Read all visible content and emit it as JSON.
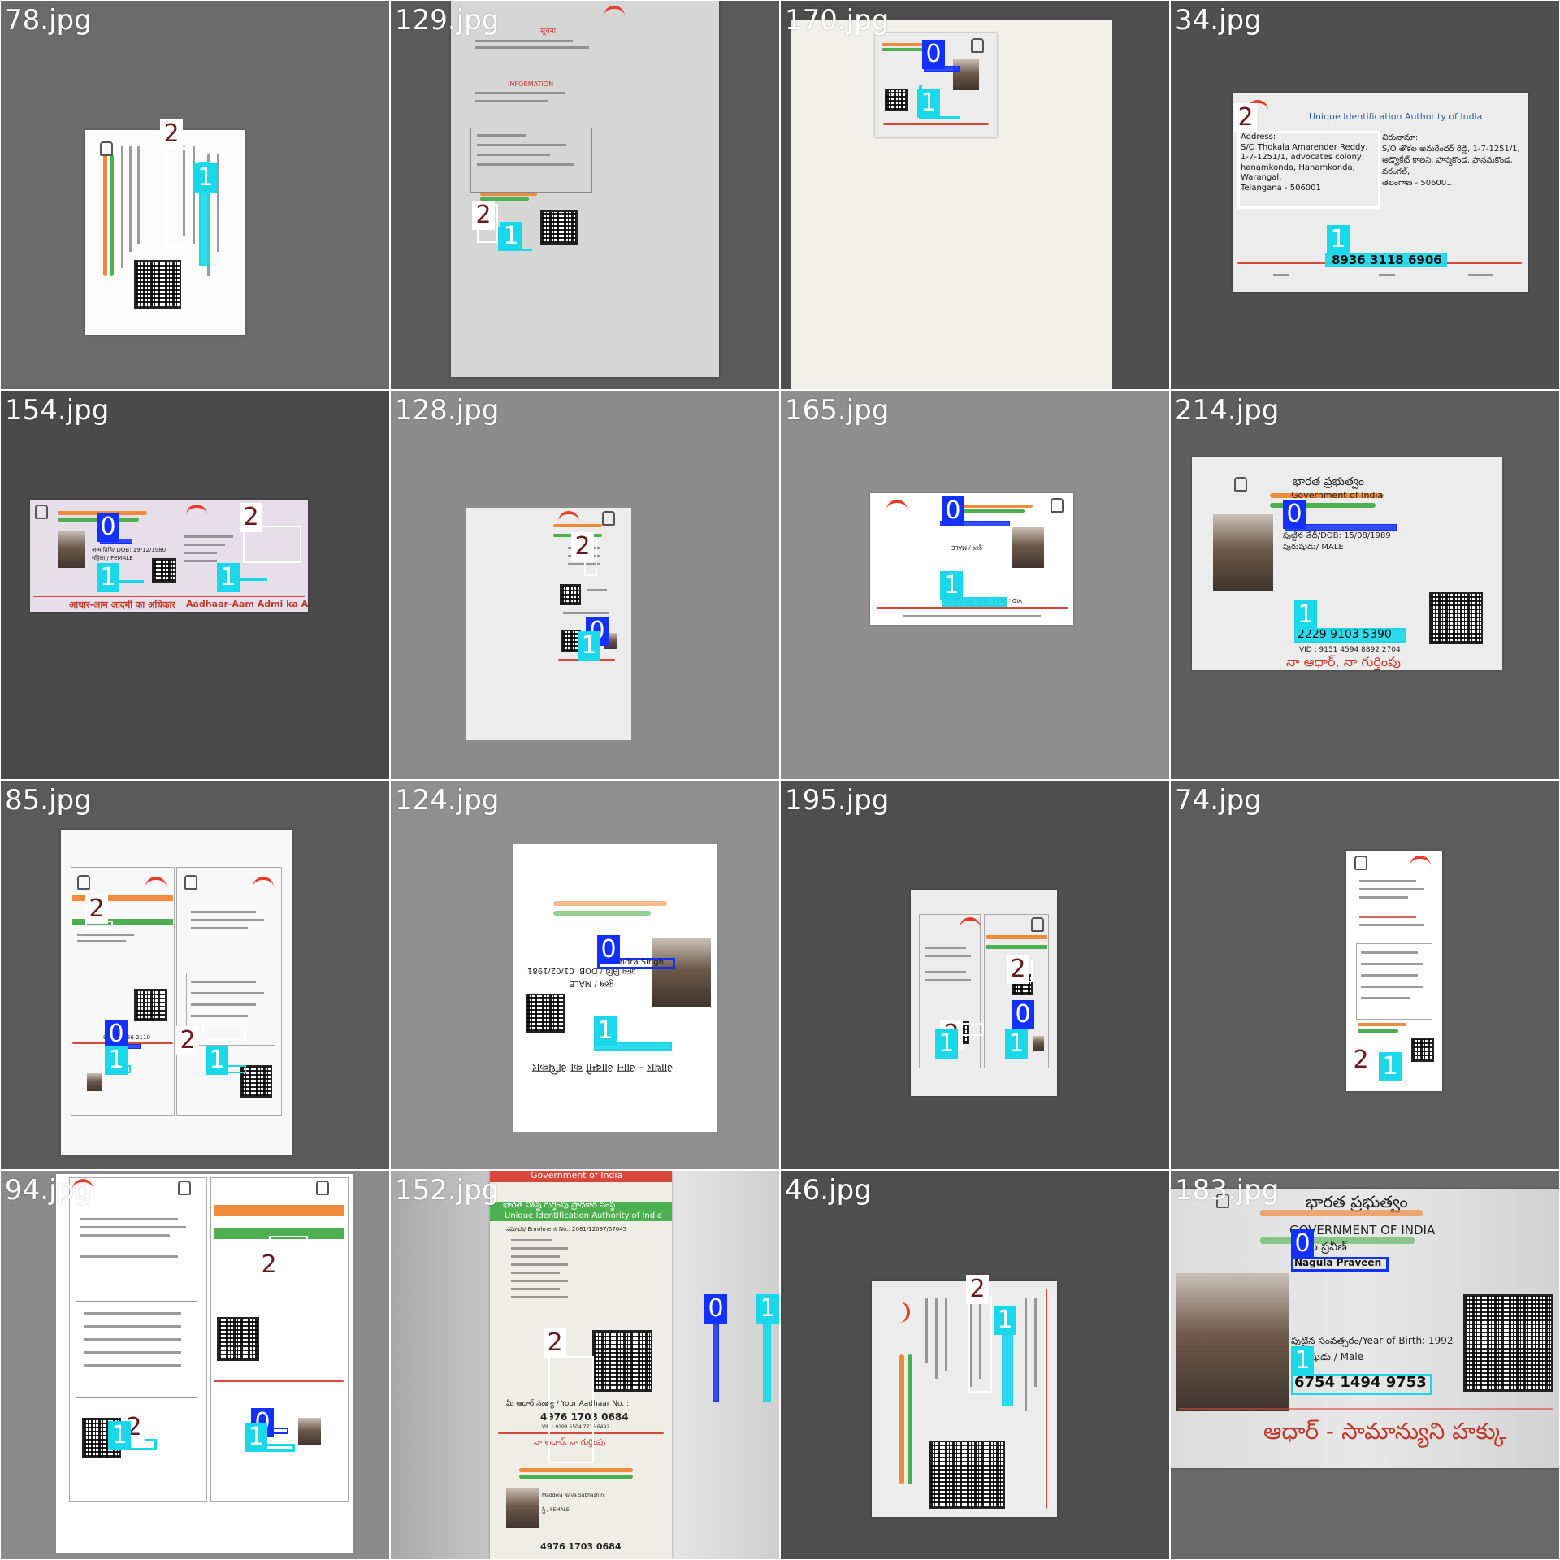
{
  "tiles": [
    {
      "file": "78.jpg",
      "bg": "#6b6b6b"
    },
    {
      "file": "129.jpg",
      "bg": "#5a5a5a"
    },
    {
      "file": "170.jpg",
      "bg": "#4d4d4d"
    },
    {
      "file": "34.jpg",
      "bg": "#4f4f4f"
    },
    {
      "file": "154.jpg",
      "bg": "#4a4a4a"
    },
    {
      "file": "128.jpg",
      "bg": "#8c8c8c"
    },
    {
      "file": "165.jpg",
      "bg": "#8e8e8e"
    },
    {
      "file": "214.jpg",
      "bg": "#5e5e5e"
    },
    {
      "file": "85.jpg",
      "bg": "#5a5a5a"
    },
    {
      "file": "124.jpg",
      "bg": "#8f8f8f"
    },
    {
      "file": "195.jpg",
      "bg": "#4f4f4f"
    },
    {
      "file": "74.jpg",
      "bg": "#5d5d5d"
    },
    {
      "file": "94.jpg",
      "bg": "#8a8a8a"
    },
    {
      "file": "152.jpg",
      "bg": "#bdbdbd"
    },
    {
      "file": "46.jpg",
      "bg": "#4e4e4e"
    },
    {
      "file": "183.jpg",
      "bg": "#6a6a6a"
    }
  ],
  "labels": {
    "l0": "0",
    "l1": "1",
    "l2": "2"
  },
  "colors": {
    "class0": "#1230ff",
    "class1": "#19d8ea",
    "class2": "#ffffff",
    "tag2_text": "#6b1a1a"
  },
  "texts": {
    "t34_address": "Address:\nS/O Thokala Amarender Reddy,\n1-7-1251/1, advocates colony,\nhanamkonda, Hanamkonda,\nWarangal,\nTelangana - 506001",
    "t34_uid": "Unique Identification Authority of India",
    "t34_number": "8936 3118 6906",
    "t34_address_te": "చిరునామా:\nS/O తోకల అమరేందర్ రెడ్డి, 1-7-1251/1,\nఅడ్వొకేట్ కాలని, హన్మకొండ, హనమకొండ,\nవరంగల్,\nతెలంగాణ - 506001",
    "t154_dob": "जन्म तिथि/ DOB: 19/12/1980",
    "t154_female": "महिला / FEMALE",
    "t154_footer_hi": "आधार-आम आदमी का अधिकार",
    "t154_footer_en": "Aadhaar-Aam Admi ka Adhikar",
    "t165_vid": "VID : 9116 4536 2605 8322",
    "t165_male": "पुरुष / MALE",
    "t214_gov_te": "భారత ప్రభుత్వం",
    "t214_gov": "Government of India",
    "t214_dob": "పుట్టిన తేదీ/DOB: 15/08/1989",
    "t214_male": "పురుషుడు/ MALE",
    "t214_number": "2229 9103 5390",
    "t214_vid": "VID : 9151 4594 8892 2704",
    "t214_footer": "నా ఆధార్, నా గుర్తింపు",
    "t124_name": "Narendra Singh",
    "t124_dob": "जन्म तिथि / DOB: 01/02/1981",
    "t124_male": "पुरुष / MALE",
    "t124_footer": "आधार - आम आदमी का अधिकार",
    "t85_number": "9114 8656 2110",
    "t152_gov": "Government of India",
    "t152_uid_te": "భారత విశిష్ట గుర్తింపు ప్రాధికార సంస్థ",
    "t152_uid": "Unique Identification Authority of India",
    "t152_enrol": "నమోదు/ Enrolment No.: 2081/12097/57645",
    "t152_your": "మీ ఆధార్ సంఖ్య / Your Aadhaar No. :",
    "t152_number": "4976 1703 0684",
    "t152_vid": "VID : 9198 5504 7716 6492",
    "t152_footer": "నా ఆధార్, నా గుర్తింపు",
    "t152_name": "Maddela Nava Subhashini",
    "t152_female": "స్త్రీ / FEMALE",
    "t152_number2": "4976 1703 0684",
    "t183_gov_te": "భారత ప్రభుత్వం",
    "t183_gov": "GOVERNMENT OF INDIA",
    "t183_name_te": "నగుల ప్రవీణ్",
    "t183_name": "Nagula Praveen",
    "t183_yob": "పుట్టిన సంవత్సరం/Year of Birth: 1992",
    "t183_male": "పురుషుడు / Male",
    "t183_number": "6754 1494 9753",
    "t183_footer": "ఆధార్ - సామాన్యుని హక్కు",
    "t129_info": "INFORMATION",
    "t129_suchna": "सूचना"
  }
}
